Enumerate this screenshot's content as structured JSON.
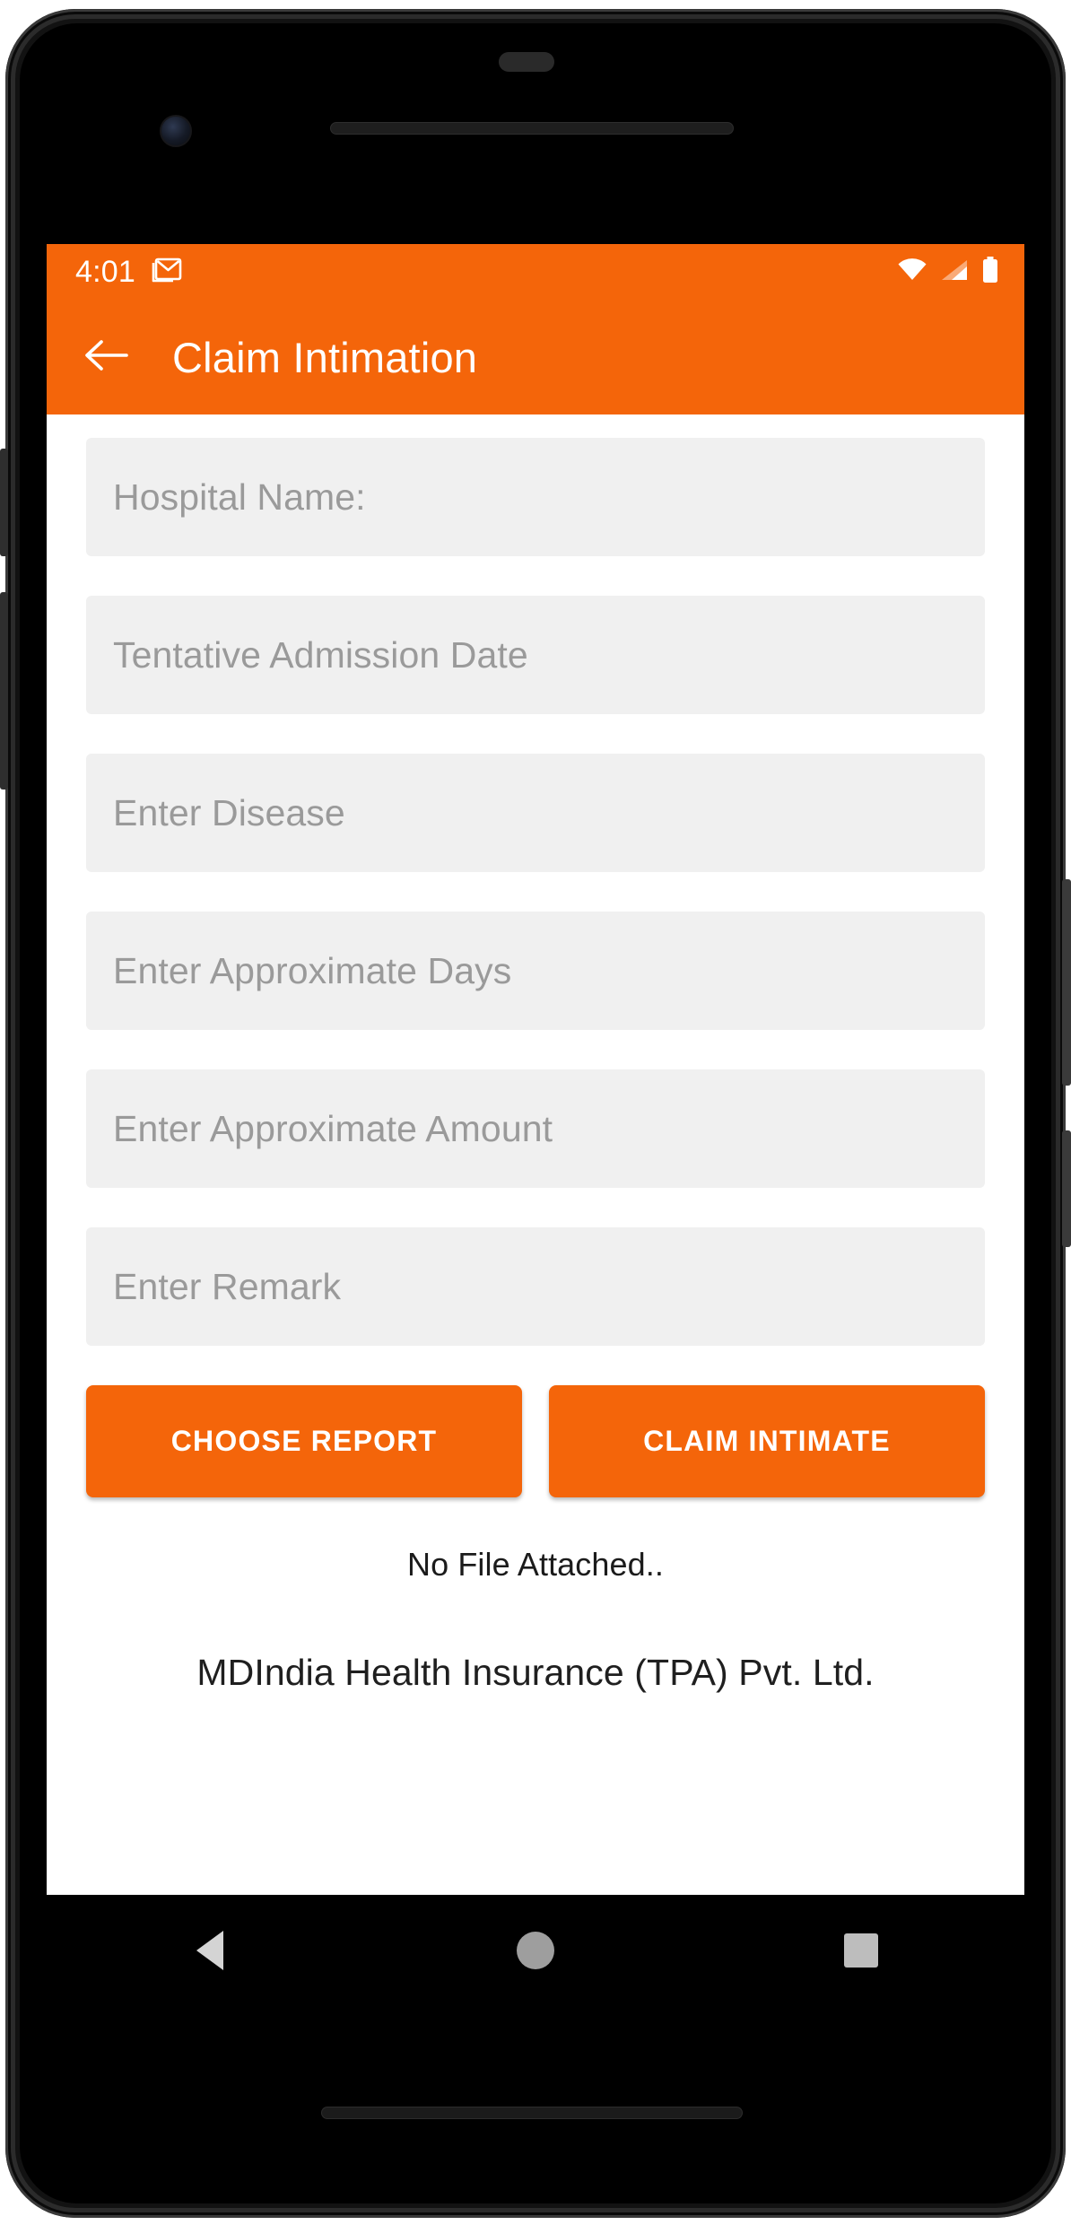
{
  "status_bar": {
    "time": "4:01",
    "icons": [
      "gmail-icon",
      "wifi-icon",
      "cellular-signal-icon",
      "battery-icon"
    ]
  },
  "app_bar": {
    "back_icon": "arrow-left-icon",
    "title": "Claim Intimation"
  },
  "form": {
    "fields": [
      {
        "name": "hospital-name",
        "placeholder": "Hospital Name:",
        "value": ""
      },
      {
        "name": "tentative-admission-date",
        "placeholder": "Tentative Admission Date",
        "value": ""
      },
      {
        "name": "disease",
        "placeholder": "Enter Disease",
        "value": ""
      },
      {
        "name": "approximate-days",
        "placeholder": "Enter Approximate Days",
        "value": ""
      },
      {
        "name": "approximate-amount",
        "placeholder": "Enter Approximate Amount",
        "value": ""
      },
      {
        "name": "remark",
        "placeholder": "Enter Remark",
        "value": ""
      }
    ]
  },
  "actions": {
    "choose_report_label": "CHOOSE REPORT",
    "claim_intimate_label": "CLAIM INTIMATE"
  },
  "attachment": {
    "status_text": "No File Attached.."
  },
  "footer": {
    "text": "MDIndia Health Insurance (TPA) Pvt. Ltd."
  },
  "navigation_bar": {
    "back_label": "back-triangle-icon",
    "home_label": "home-circle-icon",
    "recents_label": "recents-square-icon"
  },
  "colors": {
    "accent": "#F4650A",
    "field_bg": "#F0F0F0",
    "placeholder": "#9A9A9A",
    "screen_bg": "#FFFFFF",
    "nav_bg": "#000000"
  }
}
